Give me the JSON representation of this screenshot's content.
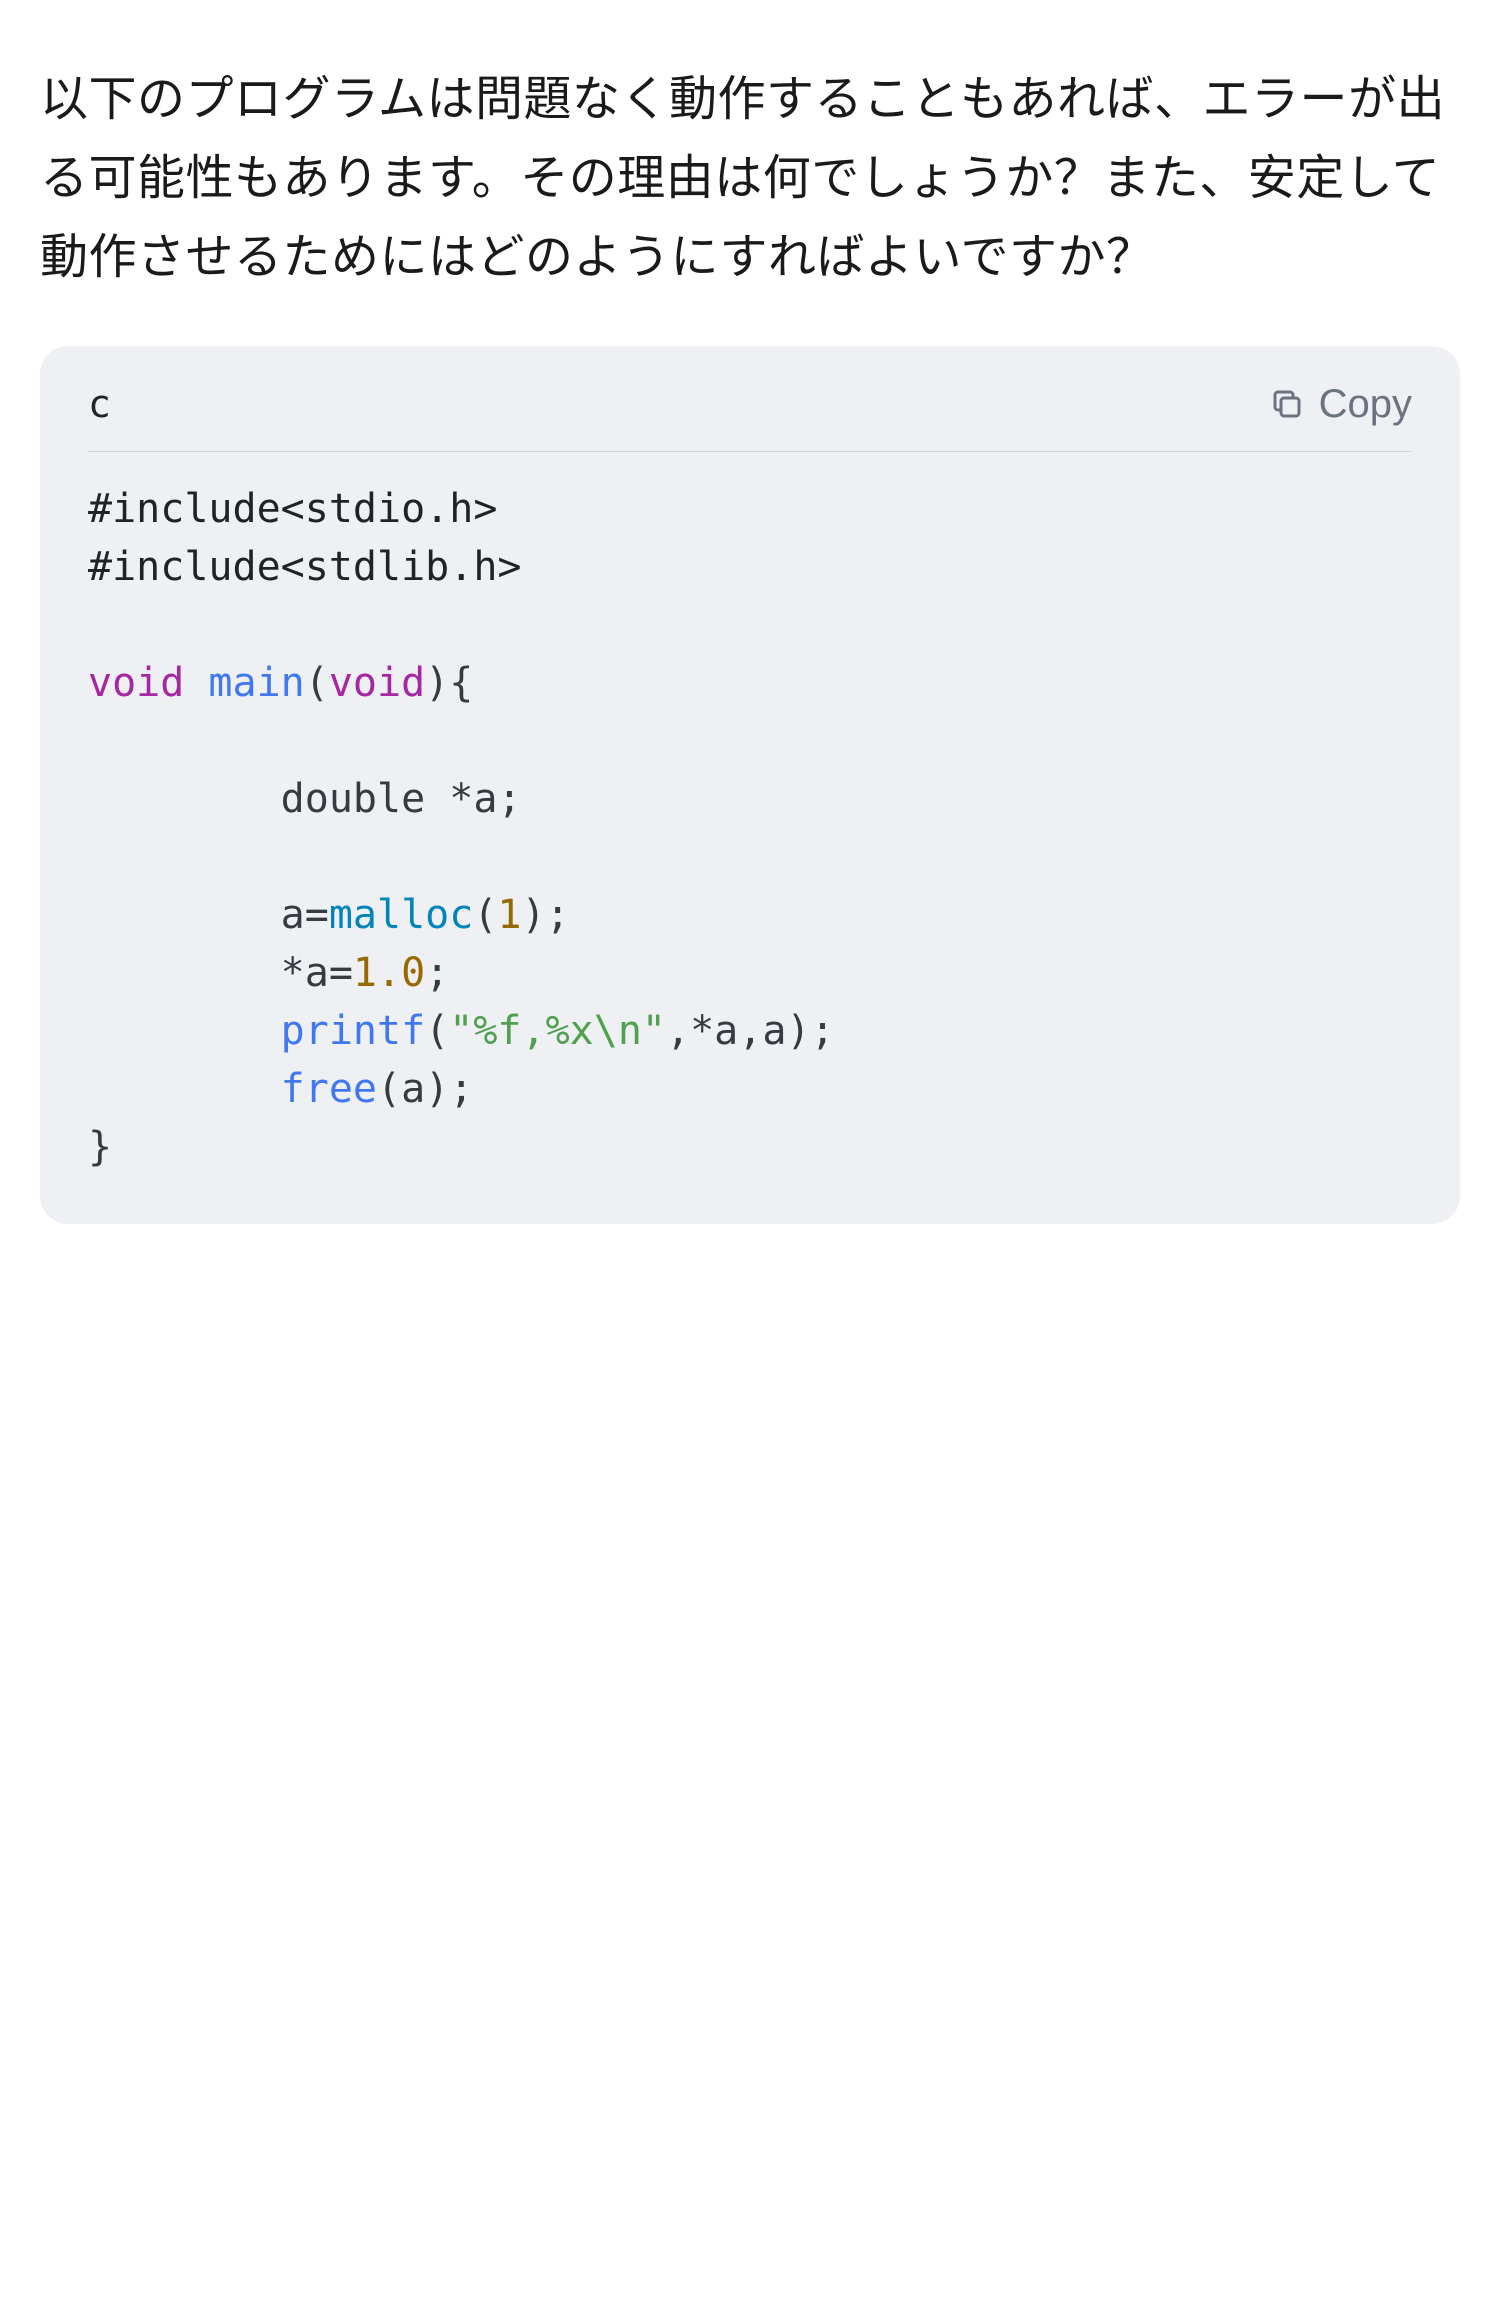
{
  "question_text": "以下のプログラムは問題なく動作することもあれば、エラーが出る可能性もあります。その理由は何でしょうか？また、安定して動作させるためにはどのようにすればよいですか？",
  "code": {
    "language_label": "c",
    "copy_label": "Copy",
    "tokens": {
      "include1": "#include<stdio.h>",
      "include2": "#include<stdlib.h>",
      "kw_void1": "void",
      "fn_main": "main",
      "paren_open1": "(",
      "kw_void2": "void",
      "paren_close_brace": "){",
      "line_decl_indent": "        double *a;",
      "indent": "        ",
      "assign_a": "a=",
      "fn_malloc": "malloc",
      "paren_open2": "(",
      "num_1": "1",
      "paren_close_semi": ");",
      "deref_assign": "*a=",
      "num_1_0": "1.0",
      "semi": ";",
      "fn_printf": "printf",
      "paren_open3": "(",
      "str_fmt": "\"%f,%x\\n\"",
      "args_tail": ",*a,a);",
      "fn_free": "free",
      "free_args": "(a);",
      "brace_close": "}"
    }
  }
}
